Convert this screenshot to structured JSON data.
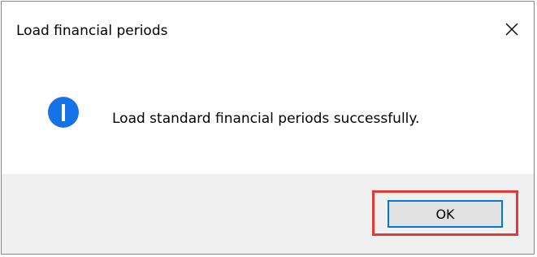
{
  "dialog": {
    "title": "Load financial periods",
    "message": "Load standard financial periods successfully.",
    "ok_label": "OK"
  },
  "icons": {
    "info": "info-icon",
    "close": "close-icon"
  },
  "colors": {
    "info_blue": "#1473e6",
    "button_focus": "#0078d7",
    "highlight_red": "#e53935",
    "footer_bg": "#f0f0f0"
  }
}
